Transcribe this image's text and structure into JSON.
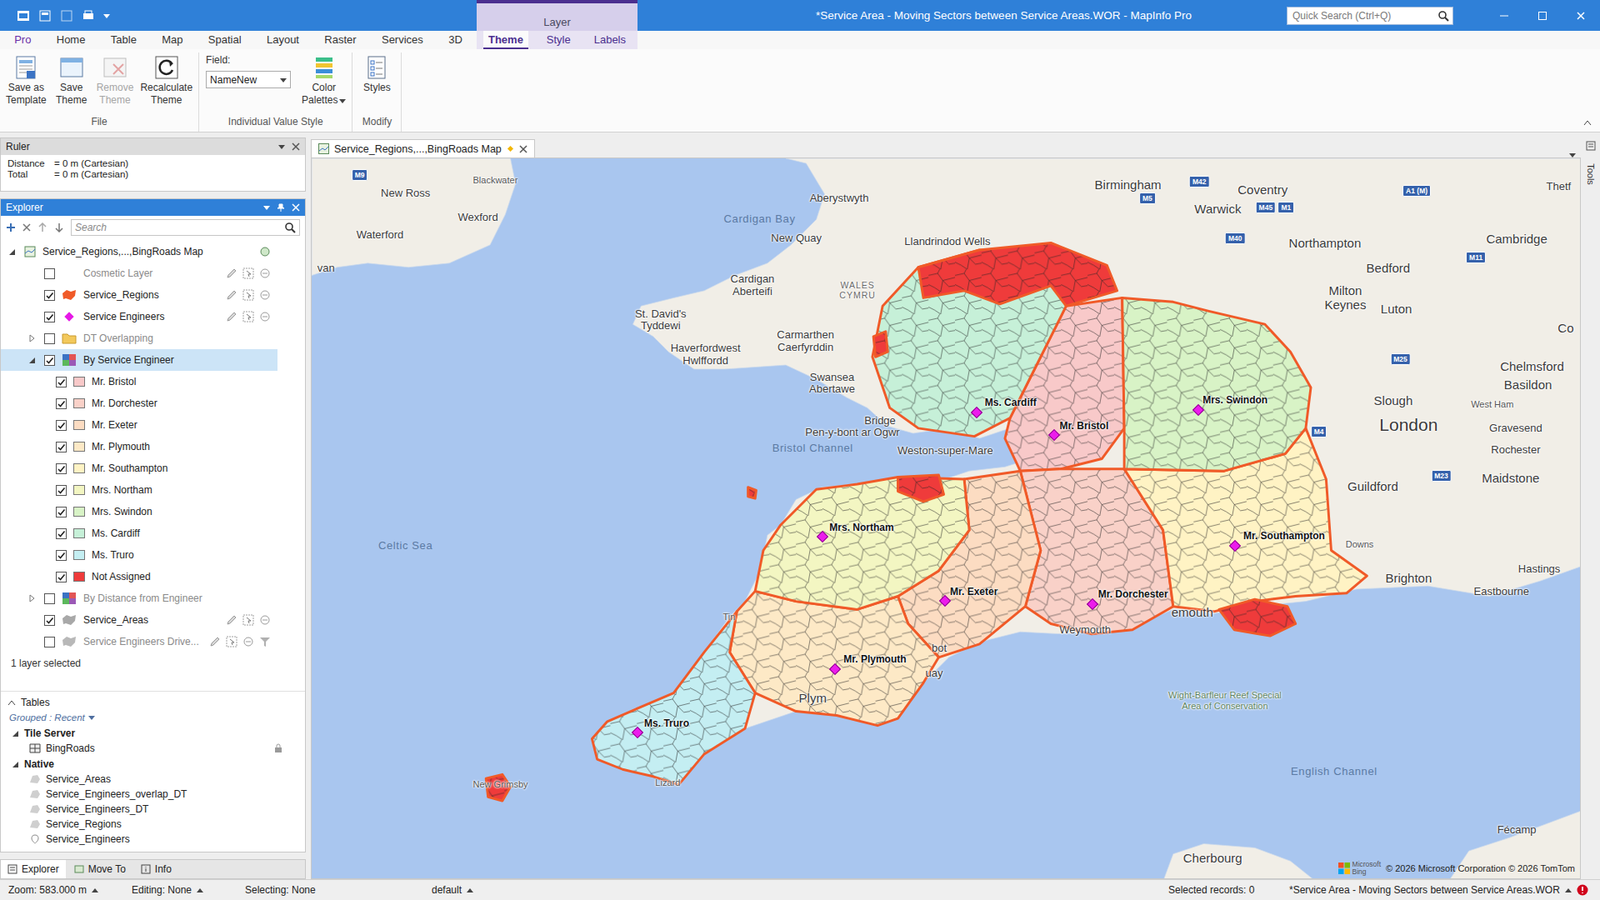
{
  "window": {
    "title": "*Service Area - Moving Sectors between Service Areas.WOR - MapInfo Pro",
    "search_placeholder": "Quick Search (Ctrl+Q)",
    "context_group": "Layer"
  },
  "ribbon_tabs": [
    {
      "label": "Pro",
      "kind": "backstage",
      "selected": false
    },
    {
      "label": "Home",
      "kind": "normal",
      "selected": false
    },
    {
      "label": "Table",
      "kind": "normal",
      "selected": false
    },
    {
      "label": "Map",
      "kind": "normal",
      "selected": false
    },
    {
      "label": "Spatial",
      "kind": "normal",
      "selected": false
    },
    {
      "label": "Layout",
      "kind": "normal",
      "selected": false
    },
    {
      "label": "Raster",
      "kind": "normal",
      "selected": false
    },
    {
      "label": "Services",
      "kind": "normal",
      "selected": false
    },
    {
      "label": "3D",
      "kind": "normal",
      "selected": false
    },
    {
      "label": "Theme",
      "kind": "contextual",
      "selected": true
    },
    {
      "label": "Style",
      "kind": "contextual",
      "selected": false
    },
    {
      "label": "Labels",
      "kind": "contextual",
      "selected": false
    }
  ],
  "ribbon_groups": [
    {
      "label": "File",
      "buttons": [
        {
          "lines": [
            "Save as",
            "Template"
          ],
          "disabled": false,
          "dropdown": false
        },
        {
          "lines": [
            "Save",
            "Theme"
          ],
          "disabled": false,
          "dropdown": false
        },
        {
          "lines": [
            "Remove",
            "Theme"
          ],
          "disabled": true,
          "dropdown": false
        },
        {
          "lines": [
            "Recalculate",
            "Theme"
          ],
          "disabled": false,
          "dropdown": false
        }
      ]
    },
    {
      "label": "Individual Value Style",
      "field": {
        "label": "Field:",
        "value": "NameNew"
      },
      "buttons": [
        {
          "lines": [
            "Color",
            "Palettes"
          ],
          "disabled": false,
          "dropdown": true
        }
      ]
    },
    {
      "label": "Modify",
      "buttons": [
        {
          "lines": [
            "Styles"
          ],
          "disabled": false,
          "dropdown": false
        }
      ]
    }
  ],
  "ruler": {
    "title": "Ruler",
    "rows": [
      {
        "label": "Distance",
        "value": "= 0 m (Cartesian)"
      },
      {
        "label": "Total",
        "value": "= 0 m (Cartesian)"
      }
    ]
  },
  "explorer": {
    "title": "Explorer",
    "search_placeholder": "Search",
    "root": {
      "label": "Service_Regions,...,BingRoads Map",
      "expanded": true
    },
    "layers": [
      {
        "label": "Cosmetic Layer",
        "kind": "layer",
        "layer_type": "cosmetic",
        "checked": false,
        "greyed": true,
        "selected": false,
        "filtered": false
      },
      {
        "label": "Service_Regions",
        "kind": "layer",
        "layer_type": "region",
        "color": "#f05a28",
        "checked": true,
        "greyed": false,
        "selected": false,
        "filtered": false
      },
      {
        "label": "Service Engineers",
        "kind": "layer",
        "layer_type": "point",
        "color": "#e619e6",
        "checked": true,
        "greyed": false,
        "selected": false,
        "filtered": false
      },
      {
        "label": "DT Overlapping",
        "kind": "group",
        "checked": false,
        "expanded": false,
        "greyed": true,
        "selected": false
      },
      {
        "label": "By Service Engineer",
        "kind": "theme",
        "checked": true,
        "expanded": true,
        "greyed": false,
        "selected": true,
        "items": [
          {
            "label": "Mr. Bristol",
            "checked": true,
            "color": "#f8c9c9"
          },
          {
            "label": "Mr. Dorchester",
            "checked": true,
            "color": "#f9d1c8"
          },
          {
            "label": "Mr. Exeter",
            "checked": true,
            "color": "#fcdcc2"
          },
          {
            "label": "Mr. Plymouth",
            "checked": true,
            "color": "#fde9c6"
          },
          {
            "label": "Mr. Southampton",
            "checked": true,
            "color": "#fff3c4"
          },
          {
            "label": "Mrs. Northam",
            "checked": true,
            "color": "#f3f6c2"
          },
          {
            "label": "Mrs. Swindon",
            "checked": true,
            "color": "#d8f3c6"
          },
          {
            "label": "Ms. Cardiff",
            "checked": true,
            "color": "#c6f0d8"
          },
          {
            "label": "Ms. Truro",
            "checked": true,
            "color": "#c4eef2"
          },
          {
            "label": "Not Assigned",
            "checked": true,
            "color": "#ef3b3b"
          }
        ]
      },
      {
        "label": "By Distance from Engineer",
        "kind": "theme",
        "checked": false,
        "expanded": false,
        "greyed": true,
        "selected": false,
        "items": []
      },
      {
        "label": "Service_Areas",
        "kind": "layer",
        "layer_type": "region",
        "color": "#a8a8a8",
        "checked": true,
        "greyed": false,
        "selected": false,
        "filtered": false
      },
      {
        "label": "Service Engineers Drive...",
        "kind": "layer",
        "layer_type": "region",
        "color": "#b8b8b8",
        "checked": false,
        "greyed": true,
        "selected": false,
        "filtered": true
      }
    ],
    "footer": "1 layer selected"
  },
  "tables": {
    "title": "Tables",
    "grouping": "Grouped : Recent",
    "groups": [
      {
        "label": "Tile Server",
        "expanded": true,
        "tables": [
          {
            "label": "BingRoads",
            "kind": "tile",
            "locked": true
          }
        ]
      },
      {
        "label": "Native",
        "expanded": true,
        "tables": [
          {
            "label": "Service_Areas",
            "kind": "region",
            "locked": false
          },
          {
            "label": "Service_Engineers_overlap_DT",
            "kind": "region",
            "locked": false
          },
          {
            "label": "Service_Engineers_DT",
            "kind": "region",
            "locked": false
          },
          {
            "label": "Service_Regions",
            "kind": "region",
            "locked": false
          },
          {
            "label": "Service_Engineers",
            "kind": "point",
            "locked": false
          }
        ]
      }
    ]
  },
  "panel_tabs": [
    {
      "label": "Explorer",
      "selected": true
    },
    {
      "label": "Move To",
      "selected": false
    },
    {
      "label": "Info",
      "selected": false
    }
  ],
  "map_window": {
    "tab": "Service_Regions,...,BingRoads Map",
    "modified": true,
    "tools_label": "Tools",
    "places": [
      {
        "lines": [
          "New Ross"
        ],
        "kind": "town"
      },
      {
        "lines": [
          "Blackwater"
        ],
        "kind": "small"
      },
      {
        "lines": [
          "Wexford"
        ],
        "kind": "town"
      },
      {
        "lines": [
          "Waterford"
        ],
        "kind": "town"
      },
      {
        "lines": [
          "van"
        ],
        "kind": "town"
      },
      {
        "lines": [
          "Aberystwyth"
        ],
        "kind": "town"
      },
      {
        "lines": [
          "Cardigan Bay"
        ],
        "kind": "water"
      },
      {
        "lines": [
          "New Quay"
        ],
        "kind": "town"
      },
      {
        "lines": [
          "Llandrindod Wells"
        ],
        "kind": "town"
      },
      {
        "lines": [
          "Cardigan",
          "Aberteifi"
        ],
        "kind": "town"
      },
      {
        "lines": [
          "WALES",
          "CYMRU"
        ],
        "kind": "region"
      },
      {
        "lines": [
          "St. David's",
          "Tyddewi"
        ],
        "kind": "town"
      },
      {
        "lines": [
          "Carmarthen",
          "Caerfyrddin"
        ],
        "kind": "town"
      },
      {
        "lines": [
          "Haverfordwest",
          "Hwlffordd"
        ],
        "kind": "town"
      },
      {
        "lines": [
          "Swansea",
          "Abertawe"
        ],
        "kind": "town"
      },
      {
        "lines": [
          "Bridge"
        ],
        "kind": "town"
      },
      {
        "lines": [
          "Pen-y-bont ar Ogwr"
        ],
        "kind": "town"
      },
      {
        "lines": [
          "Weston-super-Mare"
        ],
        "kind": "town"
      },
      {
        "lines": [
          "Bristol Channel"
        ],
        "kind": "water"
      },
      {
        "lines": [
          "Birmingham"
        ],
        "kind": "city"
      },
      {
        "lines": [
          "Coventry"
        ],
        "kind": "city"
      },
      {
        "lines": [
          "Warwick"
        ],
        "kind": "city"
      },
      {
        "lines": [
          "Northampton"
        ],
        "kind": "city"
      },
      {
        "lines": [
          "Cambridge"
        ],
        "kind": "city"
      },
      {
        "lines": [
          "Bedford"
        ],
        "kind": "city"
      },
      {
        "lines": [
          "Milton",
          "Keynes"
        ],
        "kind": "city"
      },
      {
        "lines": [
          "Luton"
        ],
        "kind": "city"
      },
      {
        "lines": [
          "Co"
        ],
        "kind": "city"
      },
      {
        "lines": [
          "Thetf"
        ],
        "kind": "town"
      },
      {
        "lines": [
          "Chelmsford"
        ],
        "kind": "city"
      },
      {
        "lines": [
          "Basildon"
        ],
        "kind": "city"
      },
      {
        "lines": [
          "Slough"
        ],
        "kind": "city"
      },
      {
        "lines": [
          "London"
        ],
        "kind": "capital"
      },
      {
        "lines": [
          "West Ham"
        ],
        "kind": "small"
      },
      {
        "lines": [
          "Gravesend"
        ],
        "kind": "town"
      },
      {
        "lines": [
          "Rochester"
        ],
        "kind": "town"
      },
      {
        "lines": [
          "Maidstone"
        ],
        "kind": "city"
      },
      {
        "lines": [
          "Guildford"
        ],
        "kind": "city"
      },
      {
        "lines": [
          "Downs"
        ],
        "kind": "small"
      },
      {
        "lines": [
          "Hastings"
        ],
        "kind": "town"
      },
      {
        "lines": [
          "Brighton"
        ],
        "kind": "city"
      },
      {
        "lines": [
          "Eastbourne"
        ],
        "kind": "town"
      },
      {
        "lines": [
          "emouth"
        ],
        "kind": "city"
      },
      {
        "lines": [
          "Weymouth"
        ],
        "kind": "town"
      },
      {
        "lines": [
          "bot"
        ],
        "kind": "town"
      },
      {
        "lines": [
          "uay"
        ],
        "kind": "town"
      },
      {
        "lines": [
          "Plym"
        ],
        "kind": "city"
      },
      {
        "lines": [
          "Tin"
        ],
        "kind": "small"
      },
      {
        "lines": [
          "Lizard"
        ],
        "kind": "small"
      },
      {
        "lines": [
          "New Grimsby"
        ],
        "kind": "small"
      },
      {
        "lines": [
          "Celtic Sea"
        ],
        "kind": "water"
      },
      {
        "lines": [
          "English Channel"
        ],
        "kind": "water"
      },
      {
        "lines": [
          "Wight-Barfleur Reef Special",
          "Area of Conservation"
        ],
        "kind": "reserve"
      },
      {
        "lines": [
          "Cherbourg"
        ],
        "kind": "city"
      },
      {
        "lines": [
          "Fécamp"
        ],
        "kind": "town"
      }
    ],
    "engineers": [
      {
        "name": "Ms. Cardiff"
      },
      {
        "name": "Mr. Bristol"
      },
      {
        "name": "Mrs. Swindon"
      },
      {
        "name": "Mrs. Northam"
      },
      {
        "name": "Mr. Southampton"
      },
      {
        "name": "Mr. Exeter"
      },
      {
        "name": "Mr. Dorchester"
      },
      {
        "name": "Mr. Plymouth"
      },
      {
        "name": "Ms. Truro"
      }
    ],
    "roads": [
      {
        "text": "M9"
      },
      {
        "text": "M42"
      },
      {
        "text": "M5"
      },
      {
        "text": "M45"
      },
      {
        "text": "M1"
      },
      {
        "text": "A1 (M)"
      },
      {
        "text": "M40"
      },
      {
        "text": "M11"
      },
      {
        "text": "M25"
      },
      {
        "text": "M4"
      },
      {
        "text": "M23"
      }
    ],
    "attribution": {
      "brand_lines": [
        "Microsoft",
        "Bing"
      ],
      "copyright": "© 2026 Microsoft Corporation © 2026 TomTom"
    }
  },
  "status_bar": [
    {
      "text": "Zoom: 583.000 m",
      "dropdown": true
    },
    {
      "text": "Editing: None",
      "dropdown": true
    },
    {
      "text": "Selecting: None",
      "dropdown": false
    },
    {
      "text": "default",
      "dropdown": true
    },
    {
      "text": "Selected records: 0",
      "dropdown": false
    },
    {
      "text": "*Service Area - Moving Sectors between Service Areas.WOR",
      "dropdown": true
    }
  ]
}
